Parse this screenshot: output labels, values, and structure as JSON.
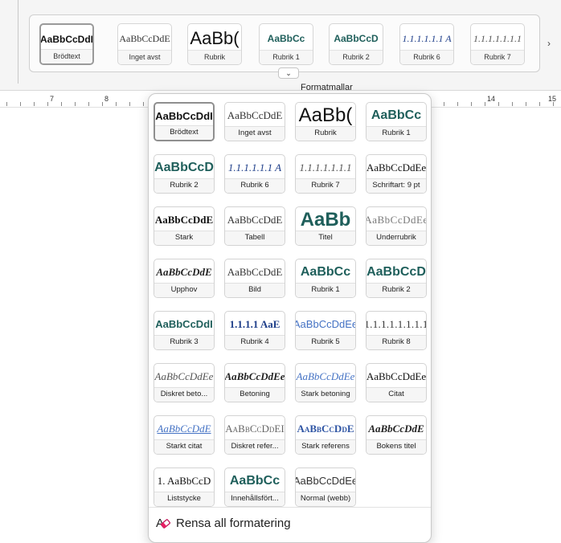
{
  "ribbon": {
    "gallery": [
      {
        "sample": "AaBbCcDdI",
        "label": "Brödtext",
        "style": "s-normal",
        "selected": true
      },
      {
        "sample": "AaBbCcDdE",
        "label": "Inget avst",
        "style": "s-serif"
      },
      {
        "sample": "AaBb(",
        "label": "Rubrik",
        "style": "s-big"
      },
      {
        "sample": "AaBbCc",
        "label": "Rubrik 1",
        "style": "s-teal-bold"
      },
      {
        "sample": "AaBbCcD",
        "label": "Rubrik 2",
        "style": "s-teal-bold"
      },
      {
        "sample": "1.1.1.1.1.1 A",
        "label": "Rubrik 6",
        "style": "s-blue-italic"
      },
      {
        "sample": "1.1.1.1.1.1.1",
        "label": "Rubrik 7",
        "style": "s-gray-italic"
      }
    ],
    "scroll_right_glyph": "›",
    "expand_glyph": "⌄",
    "section_label": "Formatmallar",
    "ruler_numbers": [
      "7",
      "8",
      "14",
      "15"
    ]
  },
  "panel": {
    "tiles": [
      {
        "sample": "AaBbCcDdI",
        "label": "Brödtext",
        "style": "s-normal",
        "selected": true
      },
      {
        "sample": "AaBbCcDdE",
        "label": "Inget avst",
        "style": "s-serif"
      },
      {
        "sample": "AaBb(",
        "label": "Rubrik",
        "style": "s-big"
      },
      {
        "sample": "AaBbCc",
        "label": "Rubrik 1",
        "style": "s-teal-bold"
      },
      {
        "sample": "AaBbCcD",
        "label": "Rubrik 2",
        "style": "s-teal-bold"
      },
      {
        "sample": "1.1.1.1.1.1 A",
        "label": "Rubrik 6",
        "style": "s-blue-italic"
      },
      {
        "sample": "1.1.1.1.1.1.1",
        "label": "Rubrik 7",
        "style": "s-gray-italic"
      },
      {
        "sample": "AaBbCcDdEe",
        "label": "Schriftart: 9 pt",
        "style": "s-serif-dark"
      },
      {
        "sample": "AaBbCcDdE",
        "label": "Stark",
        "style": "s-serif-bold"
      },
      {
        "sample": "AaBbCcDdE",
        "label": "Tabell",
        "style": "s-serif"
      },
      {
        "sample": "AaBb",
        "label": "Titel",
        "style": "s-teal-bold"
      },
      {
        "sample": "AaBbCcDdEe",
        "label": "Underrubrik",
        "style": "s-serif-gray"
      },
      {
        "sample": "AaBbCcDdE",
        "label": "Upphov",
        "style": "s-serif-bi"
      },
      {
        "sample": "AaBbCcDdE",
        "label": "Bild",
        "style": "s-serif"
      },
      {
        "sample": "AaBbCc",
        "label": "Rubrik 1",
        "style": "s-teal-bold"
      },
      {
        "sample": "AaBbCcD",
        "label": "Rubrik 2",
        "style": "s-teal-bold"
      },
      {
        "sample": "AaBbCcDdI",
        "label": "Rubrik 3",
        "style": "s-teal-bold"
      },
      {
        "sample": "1.1.1.1 AaE",
        "label": "Rubrik 4",
        "style": "s-blue-serif-bold"
      },
      {
        "sample": "AaBbCcDdEe",
        "label": "Rubrik 5",
        "style": "s-blue-light"
      },
      {
        "sample": "1.1.1.1.1.1.1.1",
        "label": "Rubrik 8",
        "style": "s-mono"
      },
      {
        "sample": "AaBbCcDdEe",
        "label": "Diskret beto...",
        "style": "s-italic-serif"
      },
      {
        "sample": "AaBbCcDdEe",
        "label": "Betoning",
        "style": "s-serif-bi"
      },
      {
        "sample": "AaBbCcDdEe",
        "label": "Stark betoning",
        "style": "s-blue-italic2"
      },
      {
        "sample": "AaBbCcDdEe",
        "label": "Citat",
        "style": "s-serif-dark"
      },
      {
        "sample": "AaBbCcDdE",
        "label": "Starkt citat",
        "style": "s-blue-ul"
      },
      {
        "sample": "AaBbCcDdEI",
        "label": "Diskret refer...",
        "style": "s-smallcaps-gray"
      },
      {
        "sample": "AaBbCcDdE",
        "label": "Stark referens",
        "style": "s-smallcaps-blue"
      },
      {
        "sample": "AaBbCcDdE",
        "label": "Bokens titel",
        "style": "s-serif-bi"
      },
      {
        "sample": "1. AaBbCcD",
        "label": "Liststycke",
        "style": "s-serif-dark"
      },
      {
        "sample": "AaBbCc",
        "label": "Innehållsfört...",
        "style": "s-teal-bold"
      },
      {
        "sample": "AaBbCcDdEe",
        "label": "Normal (webb)",
        "style": "s-sans-plain"
      }
    ],
    "clear_formatting_label": "Rensa all formatering",
    "clear_icon": "clear-formatting-icon"
  }
}
